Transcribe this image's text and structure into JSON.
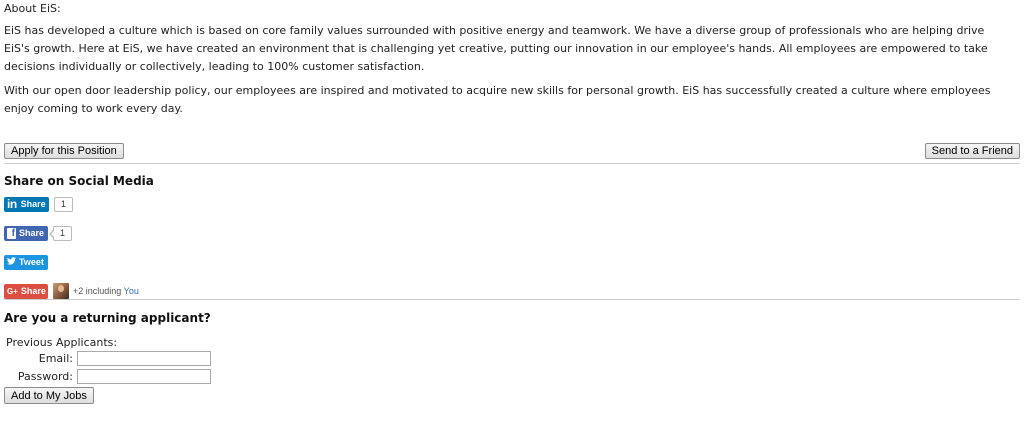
{
  "about": {
    "heading": "About EiS:",
    "paragraph1": "EiS has developed a culture which is based on core family values surrounded with positive energy and teamwork. We have a diverse group of professionals who are helping drive EiS's growth. Here at EiS, we have created an environment that is challenging yet creative, putting our innovation in our employee's hands. All employees are empowered to take decisions individually or collectively, leading to 100% customer satisfaction.",
    "paragraph2": "With our open door leadership policy, our employees are inspired and motivated to acquire new skills for personal growth. EiS has successfully created a culture where employees enjoy coming to work every day."
  },
  "actions": {
    "apply_label": "Apply for this Position",
    "send_label": "Send to a Friend"
  },
  "social": {
    "heading": "Share on Social Media",
    "linkedin": {
      "icon": "linkedin-icon",
      "glyph": "in",
      "label": "Share",
      "count": "1",
      "color": "#0077b5"
    },
    "facebook": {
      "icon": "facebook-icon",
      "glyph": "f",
      "label": "Share",
      "count": "1",
      "color": "#4267b2"
    },
    "twitter": {
      "icon": "twitter-bird-icon",
      "glyph": "🐦",
      "label": "Tweet",
      "color": "#1b95e0"
    },
    "googleplus": {
      "icon": "google-plus-icon",
      "glyph": "G+",
      "label": "Share",
      "color": "#dc4e41",
      "plus_text": "+2 including",
      "you_link": "You"
    }
  },
  "returning": {
    "heading": "Are you a returning applicant?",
    "previous_label": "Previous Applicants:",
    "email_label": "Email:",
    "email_value": "",
    "password_label": "Password:",
    "password_value": "",
    "add_label": "Add to My Jobs"
  }
}
